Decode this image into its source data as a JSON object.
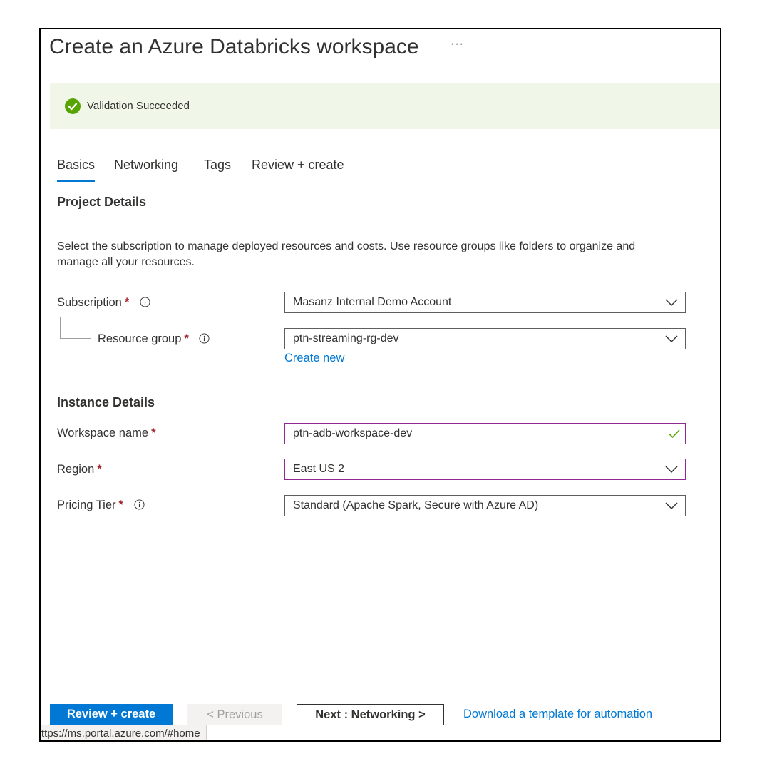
{
  "page": {
    "title": "Create an Azure Databricks workspace",
    "more_label": "···"
  },
  "banner": {
    "status_text": "Validation Succeeded",
    "status_color": "#57a300",
    "icon": "check-circle-icon"
  },
  "tabs": [
    {
      "label": "Basics",
      "active": true
    },
    {
      "label": "Networking",
      "active": false
    },
    {
      "label": "Tags",
      "active": false
    },
    {
      "label": "Review + create",
      "active": false
    }
  ],
  "project": {
    "heading": "Project Details",
    "description": "Select the subscription to manage deployed resources and costs. Use resource groups like folders to organize and manage all your resources.",
    "subscription": {
      "label": "Subscription",
      "required": "*",
      "value": "Masanz Internal Demo Account"
    },
    "resource_group": {
      "label": "Resource group",
      "required": "*",
      "value": "ptn-streaming-rg-dev",
      "create_new": "Create new"
    }
  },
  "instance": {
    "heading": "Instance Details",
    "workspace_name": {
      "label": "Workspace name",
      "required": "*",
      "value": "ptn-adb-workspace-dev"
    },
    "region": {
      "label": "Region",
      "required": "*",
      "value": "East US 2"
    },
    "pricing_tier": {
      "label": "Pricing Tier",
      "required": "*",
      "value": "Standard (Apache Spark, Secure with Azure AD)"
    }
  },
  "footer": {
    "review_create": "Review + create",
    "previous": "< Previous",
    "next": "Next : Networking >",
    "download_template": "Download a template for automation"
  },
  "status_bar": {
    "url": "ttps://ms.portal.azure.com/#home"
  },
  "colors": {
    "accent": "#0078d4",
    "required": "#a4262c",
    "focus_border": "#8f2891",
    "banner_bg": "#f0f7e8"
  }
}
